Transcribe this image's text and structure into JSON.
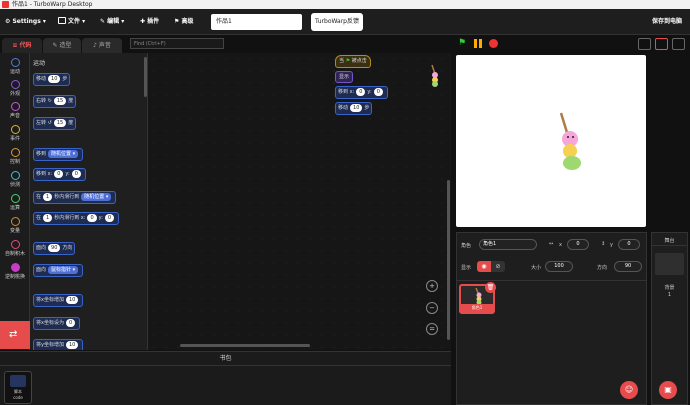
{
  "titlebar": {
    "title": "作品1 - TurboWarp Desktop"
  },
  "menu": {
    "settings": "Settings",
    "file": "文件",
    "edit": "编辑",
    "addons": "插件",
    "advanced": "高级",
    "project_title": "作品1",
    "feedback": "TurboWarp反馈",
    "save": "保存到电脑"
  },
  "tabs": {
    "code": "代码",
    "costumes": "造型",
    "sounds": "声音"
  },
  "find": {
    "placeholder": "Find (Ctrl+F)"
  },
  "categories": [
    {
      "label": "运动",
      "color": "#4c7de0"
    },
    {
      "label": "外观",
      "color": "#8a5be0"
    },
    {
      "label": "声音",
      "color": "#c75be0"
    },
    {
      "label": "事件",
      "color": "#e0b32e"
    },
    {
      "label": "控制",
      "color": "#e09b2e"
    },
    {
      "label": "侦测",
      "color": "#4cb8e0"
    },
    {
      "label": "运算",
      "color": "#4cd06a"
    },
    {
      "label": "变量",
      "color": "#e08a2e"
    },
    {
      "label": "自制积木",
      "color": "#e0507a"
    },
    {
      "label": "逆制桃换",
      "color": "#c63cc6"
    }
  ],
  "palette": {
    "section": "运动",
    "b1a": "移动",
    "b1v": "10",
    "b1b": "步",
    "b2a": "右转",
    "b2v": "15",
    "b2b": "度",
    "b3a": "左转",
    "b3v": "15",
    "b3b": "度",
    "b4a": "移到",
    "b4v": "随机位置",
    "b5a": "移到 x:",
    "b5x": "0",
    "b5y": "y:",
    "b5yv": "0",
    "b6a": "在",
    "b6v": "1",
    "b6b": "秒内滑行到",
    "b6c": "随机位置",
    "b7a": "在",
    "b7v": "1",
    "b7b": "秒内滑行到 x:",
    "b7x": "0",
    "b7y": "y:",
    "b7yv": "0",
    "b8a": "面向",
    "b8v": "90",
    "b8b": "方向",
    "b9a": "面向",
    "b9v": "鼠标指针",
    "b10a": "将x坐标增加",
    "b10v": "10",
    "b11a": "将x坐标设为",
    "b11v": "0",
    "b12a": "将y坐标增加",
    "b12v": "10"
  },
  "script": {
    "hat_a": "当",
    "hat_b": "被点击",
    "show": "显示",
    "goto_a": "移到 x:",
    "goto_x": "0",
    "goto_y": "y:",
    "goto_yv": "0",
    "move_a": "移动",
    "move_v": "10",
    "move_b": "步"
  },
  "backpack": {
    "title": "书包",
    "item_label": "脚本",
    "item_sub": "code"
  },
  "sprite_info": {
    "sprite_label": "角色",
    "sprite_name": "角色1",
    "x_label": "x",
    "x": "0",
    "y_label": "y",
    "y": "0",
    "show_label": "显示",
    "size_label": "大小",
    "size": "100",
    "direction_label": "方向",
    "direction": "90"
  },
  "sprites": [
    {
      "name": "角色1"
    }
  ],
  "stage_col": {
    "title": "舞台",
    "backdrops_label": "背景",
    "backdrops_count": "1"
  },
  "colors": {
    "accent": "#e74c4c",
    "motion": "#4c7de0"
  }
}
